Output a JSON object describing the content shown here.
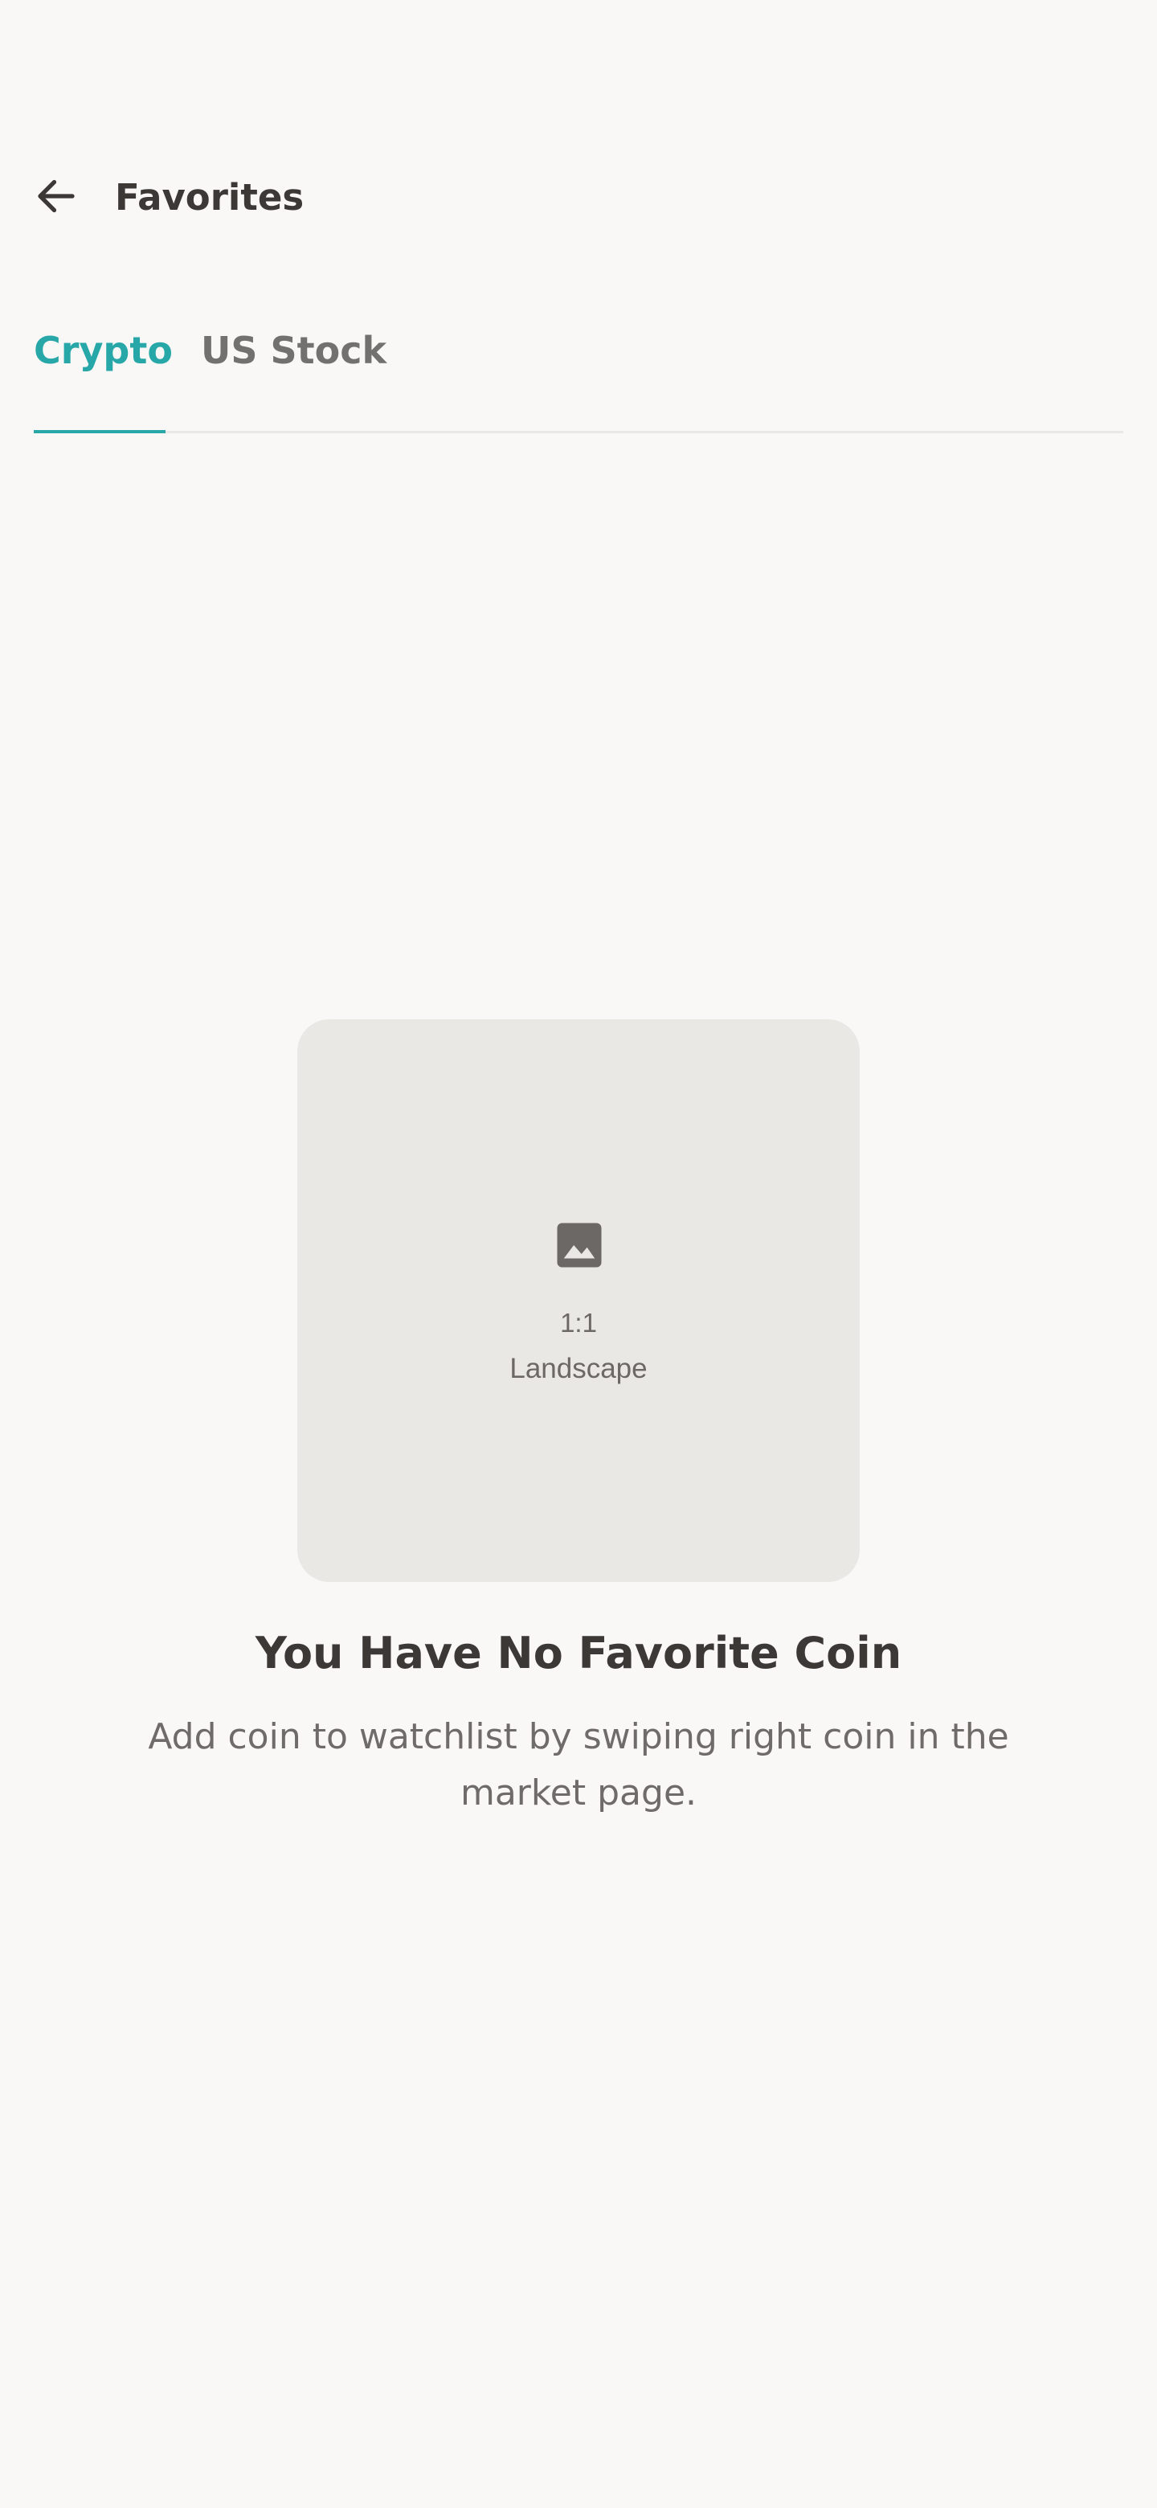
{
  "header": {
    "back_icon": "arrow-left-icon",
    "title": "Favorites"
  },
  "tabs": [
    {
      "label": "Crypto",
      "active": true
    },
    {
      "label": "US Stock",
      "active": false
    }
  ],
  "colors": {
    "accent": "#27a7a7",
    "background": "#f9f8f6",
    "placeholder_bg": "#eae8e5",
    "text_primary": "#3b3836",
    "text_secondary": "#6e6b69"
  },
  "empty_state": {
    "image_icon": "image-icon",
    "image_ratio": "1:1",
    "image_orientation": "Landscape",
    "title": "You Have No Favorite Coin",
    "description": "Add coin to watchlist by swiping right coin in the market page."
  }
}
